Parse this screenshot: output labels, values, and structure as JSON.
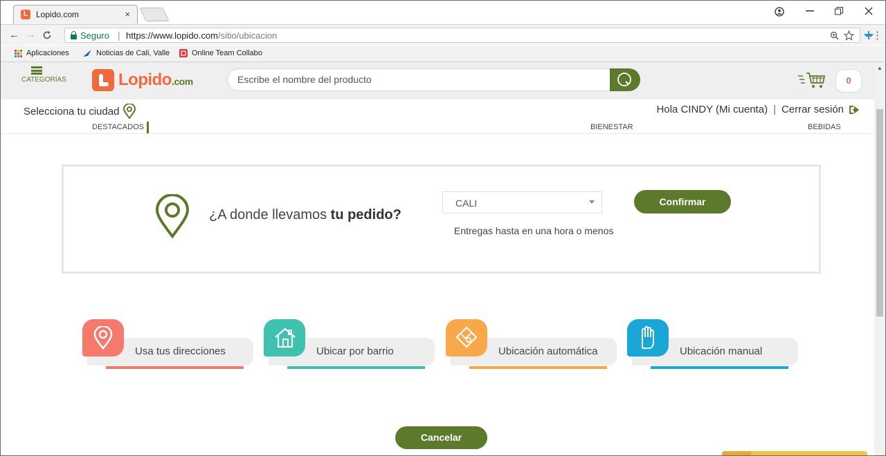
{
  "browser": {
    "tab_title": "Lopido.com",
    "tab_close": "×",
    "secure_label": "Seguro",
    "url_host": "https://www.lopido.com",
    "url_path": "/sitio/ubicacion",
    "bookmarks": [
      {
        "label": "Aplicaciones"
      },
      {
        "label": "Noticias de Cali, Valle"
      },
      {
        "label": "Online Team Collabo"
      }
    ]
  },
  "header": {
    "categories_label": "CATEGORÍAS",
    "logo_text": "Lopido",
    "logo_suffix": ".com",
    "search_placeholder": "Escribe el nombre del producto",
    "cart_count": "0"
  },
  "subheader": {
    "city_label": "Selecciona tu ciudad",
    "greeting": "Hola CINDY (Mi cuenta)",
    "separator": "|",
    "logout": "Cerrar sesión"
  },
  "catnav": {
    "items": [
      {
        "label": "DESTACADOS"
      },
      {
        "label": "BIENESTAR"
      },
      {
        "label": "BEBIDAS"
      }
    ]
  },
  "location": {
    "question_prefix": "¿A donde llevamos ",
    "question_bold": "tu pedido?",
    "selected_city": "CALI",
    "confirm_label": "Confirmar",
    "delivery_note": "Entregas hasta en una hora o menos"
  },
  "options": [
    {
      "label": "Usa tus direcciones",
      "icon": "location-pin-icon",
      "color": "#f47b6b"
    },
    {
      "label": "Ubicar por barrio",
      "icon": "house-icon",
      "color": "#3fc1b0"
    },
    {
      "label": "Ubicación automática",
      "icon": "map-icon",
      "color": "#f7a94a"
    },
    {
      "label": "Ubicación manual",
      "icon": "hand-icon",
      "color": "#1aa7d8"
    }
  ],
  "cancel_label": "Cancelar",
  "colors": {
    "brand_green": "#5c7a2b",
    "brand_orange": "#f26a3b"
  }
}
